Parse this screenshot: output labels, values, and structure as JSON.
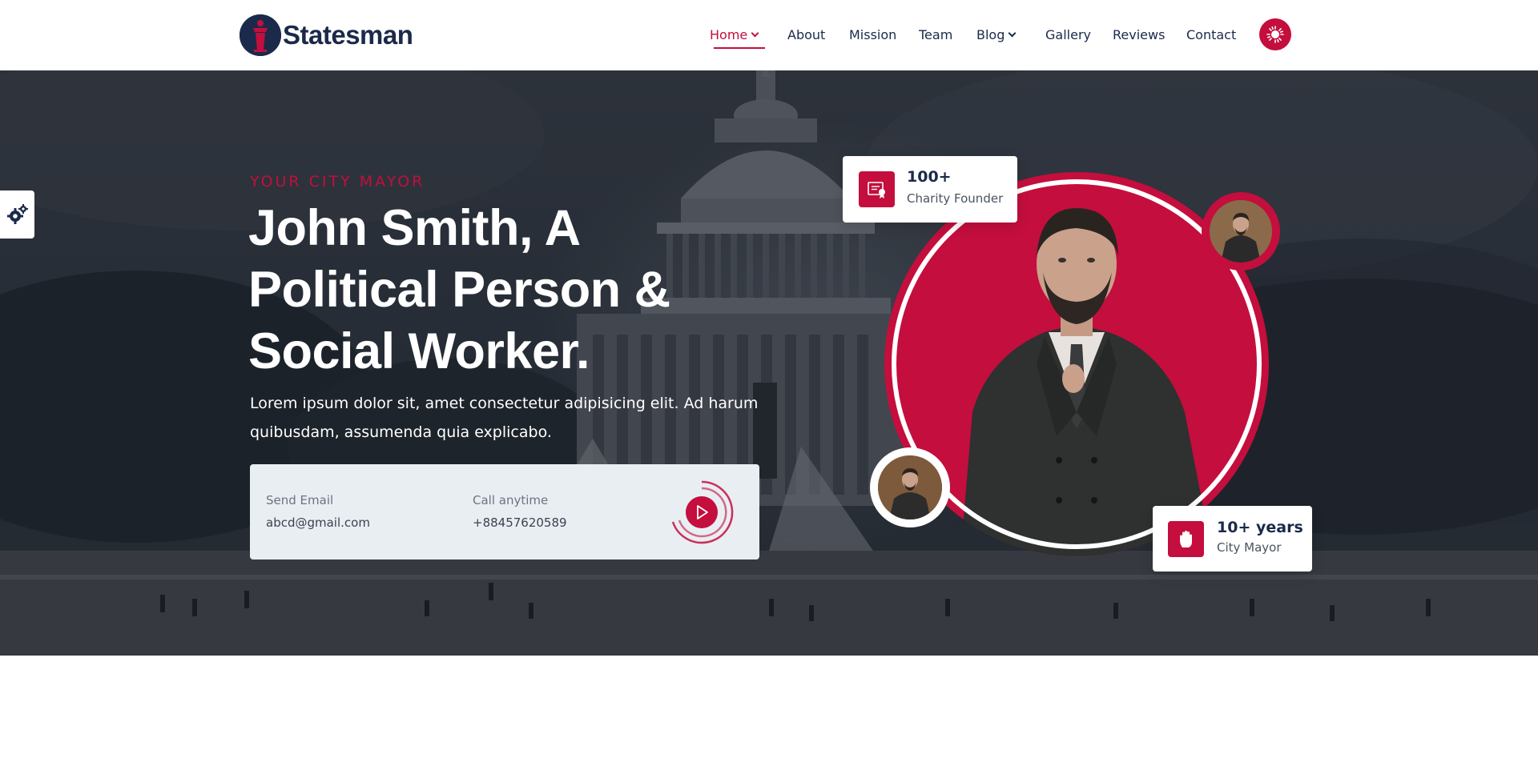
{
  "brand": {
    "name": "Statesman",
    "logo_icon": "podium-icon"
  },
  "nav": {
    "items": [
      {
        "label": "Home",
        "has_dropdown": true,
        "active": true
      },
      {
        "label": "About"
      },
      {
        "label": "Mission"
      },
      {
        "label": "Team"
      },
      {
        "label": "Blog",
        "has_dropdown": true
      },
      {
        "label": "Gallery"
      },
      {
        "label": "Reviews"
      },
      {
        "label": "Contact"
      }
    ],
    "theme_toggle_icon": "sun-icon"
  },
  "settings_icon": "gear-icon",
  "hero": {
    "eyebrow": "YOUR CITY MAYOR",
    "headline": [
      "John Smith, A",
      "Political Person &",
      "Social Worker."
    ],
    "lead": "Lorem ipsum dolor sit, amet consectetur adipisicing elit. Ad harum quibusdam, assumenda quia explicabo.",
    "contact": {
      "email_label": "Send Email",
      "email_value": "abcd@gmail.com",
      "phone_label": "Call anytime",
      "phone_value": "+88457620589",
      "play_icon": "play-icon"
    },
    "stats": [
      {
        "number": "100+",
        "label": "Charity Founder",
        "icon": "certificate-icon"
      },
      {
        "number": "10+ years",
        "label": "City Mayor",
        "icon": "hand-icon"
      }
    ]
  },
  "colors": {
    "accent": "#c40e3d",
    "navy": "#1b2a4a",
    "card_bg": "#e9eef3"
  }
}
